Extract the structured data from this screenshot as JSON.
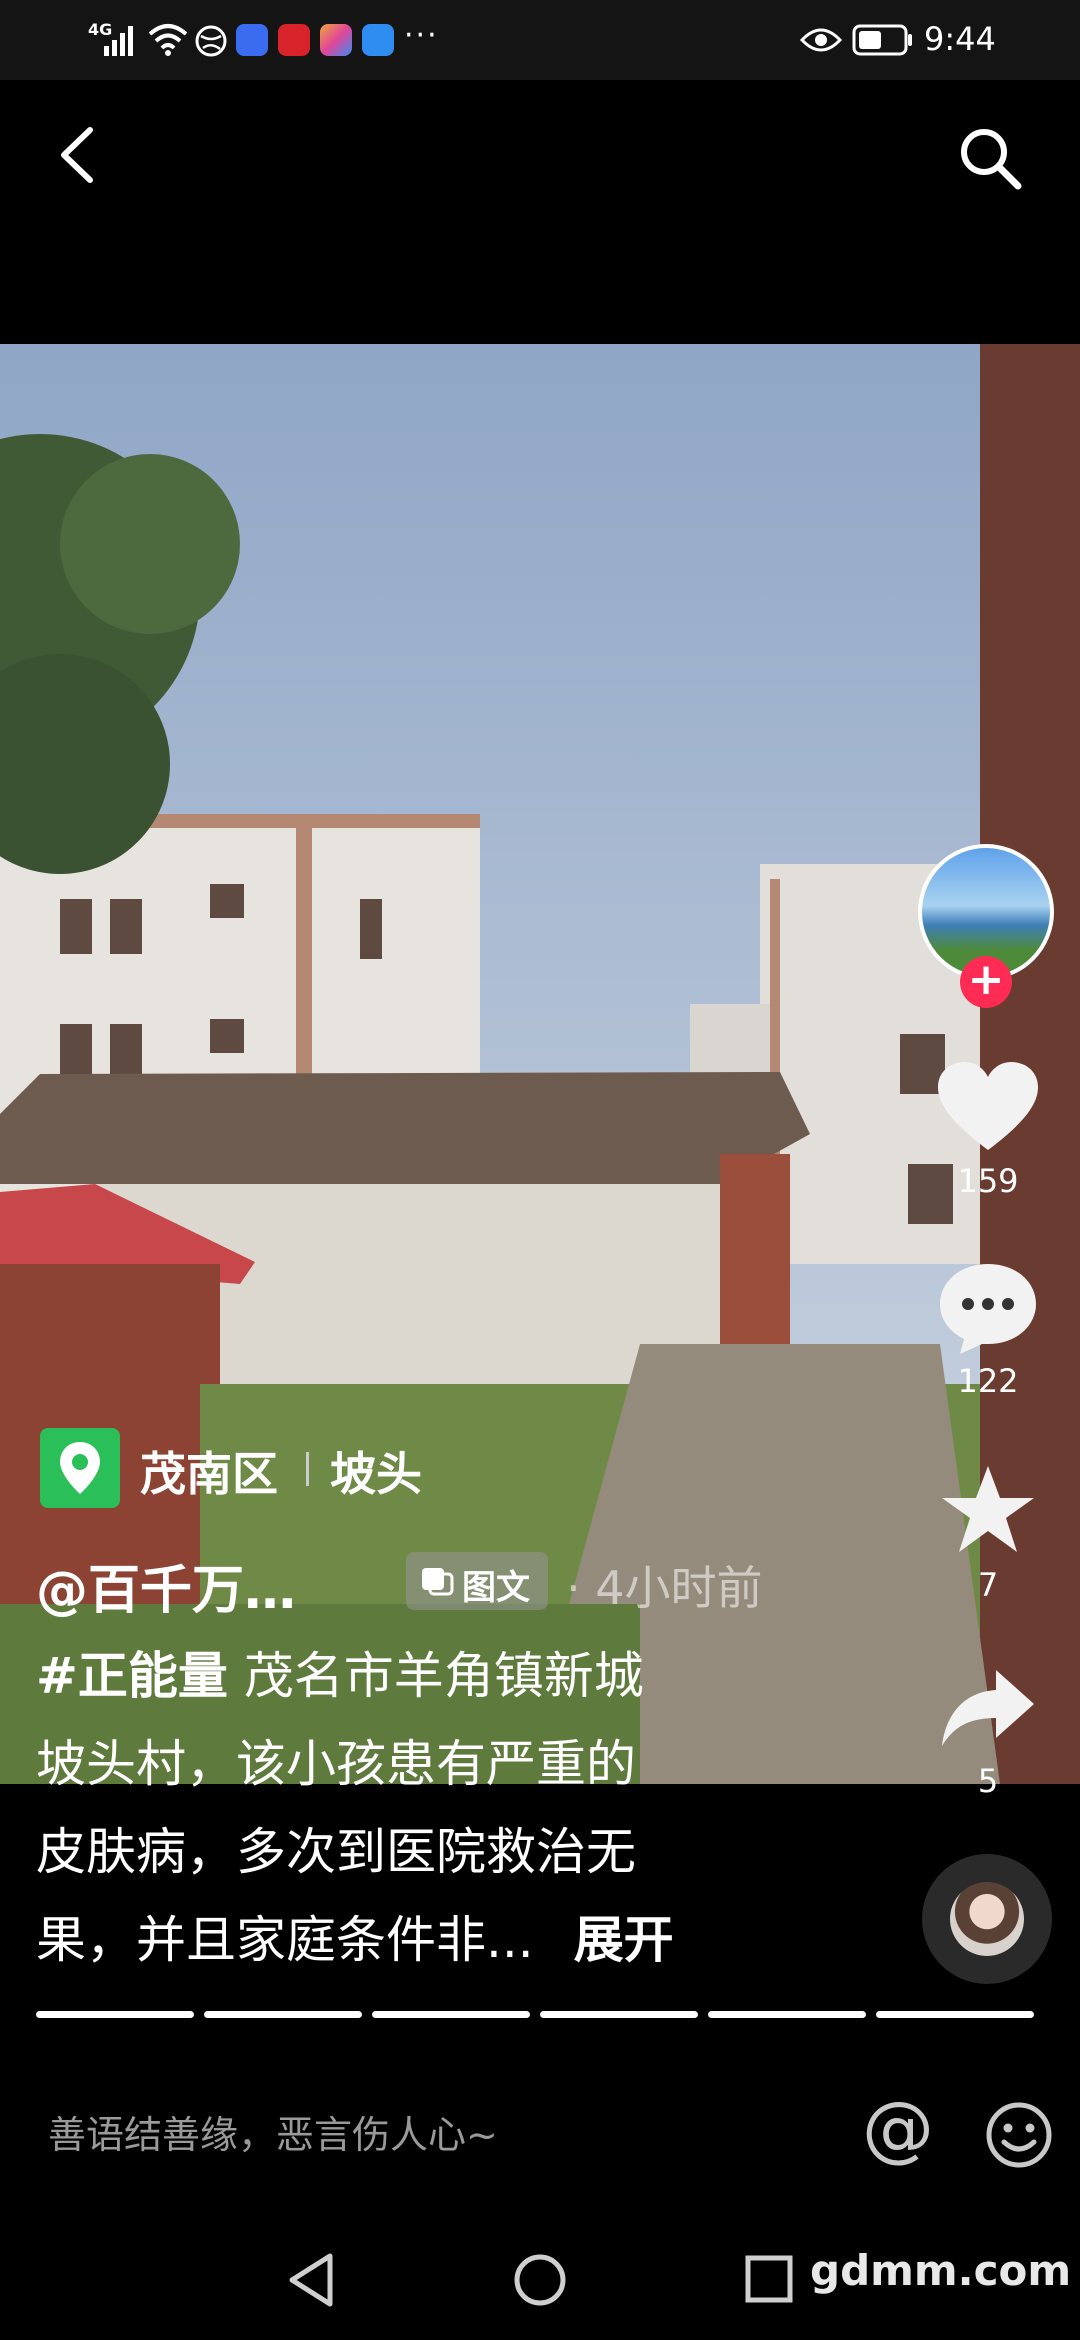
{
  "status_bar": {
    "network": "4G",
    "time": "9:44",
    "more": "···",
    "app_icon_colors": [
      "#3b6cf0",
      "#d8232a",
      "#f2a43a",
      "#2f8cf0"
    ]
  },
  "nav": {
    "back_icon": "chevron-left-icon",
    "search_icon": "search-icon"
  },
  "location": {
    "district": "茂南区",
    "place": "坡头",
    "icon_color": "#2bbf5a"
  },
  "post": {
    "author": "@百千万…",
    "badge_label": "图文",
    "time_ago": "· 4小时前",
    "hashtag": "#正能量",
    "description_line1_rest": " 茂名市羊角镇新城",
    "description_line2": "坡头村，该小孩患有严重的",
    "description_line3": "皮肤病，多次到医院救治无",
    "description_line4": "果，并且家庭条件非...",
    "expand_label": "展开"
  },
  "actions": {
    "likes": "159",
    "comments": "122",
    "favorites": "7",
    "shares": "5"
  },
  "progress": {
    "total_segments": 6,
    "accent": "#ffffff"
  },
  "comment_bar": {
    "placeholder": "善语结善缘，恶言伤人心~",
    "at_symbol": "@"
  },
  "system_nav": {
    "watermark": "gdmm.com"
  },
  "colors": {
    "follow_plus": "#fe2c55",
    "background": "#000000"
  }
}
